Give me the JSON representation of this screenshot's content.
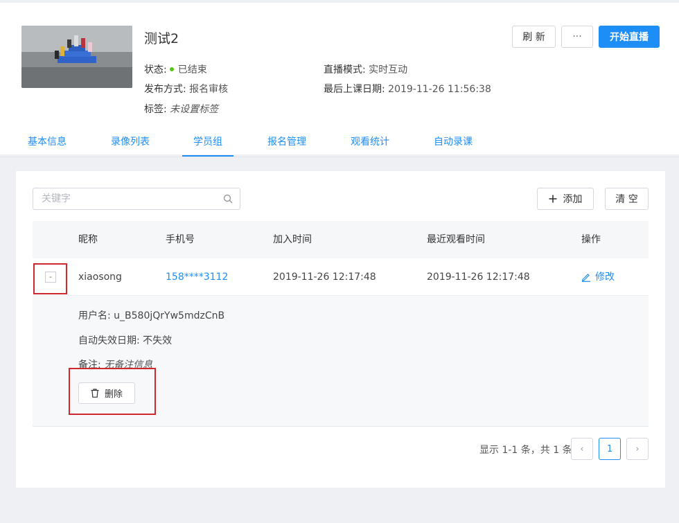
{
  "course": {
    "title": "测试2",
    "status_label": "状态:",
    "status_value": "已结束",
    "publish_label": "发布方式:",
    "publish_value": "报名审核",
    "tags_label": "标签:",
    "tags_value": "未设置标签",
    "mode_label": "直播模式:",
    "mode_value": "实时互动",
    "last_class_label": "最后上课日期:",
    "last_class_value": "2019-11-26 11:56:38"
  },
  "actions": {
    "refresh": "刷 新",
    "more": "···",
    "start": "开始直播"
  },
  "tabs": [
    {
      "label": "基本信息"
    },
    {
      "label": "录像列表"
    },
    {
      "label": "学员组"
    },
    {
      "label": "报名管理"
    },
    {
      "label": "观看统计"
    },
    {
      "label": "自动录课"
    }
  ],
  "toolbar": {
    "search_placeholder": "关键字",
    "add_label": "添加",
    "clear_label": "清 空"
  },
  "table": {
    "headers": [
      "昵称",
      "手机号",
      "加入时间",
      "最近观看时间",
      "操作"
    ],
    "rows": [
      {
        "expander": "-",
        "nickname": "xiaosong",
        "phone": "158****3112",
        "joined": "2019-11-26 12:17:48",
        "last_watch": "2019-11-26 12:17:48",
        "action": "修改"
      }
    ]
  },
  "detail": {
    "username_label": "用户名:",
    "username_value": "u_B580jQrYw5mdzCnB",
    "expire_label": "自动失效日期:",
    "expire_value": "不失效",
    "note_label": "备注:",
    "note_value": "无备注信息",
    "delete_label": "删除"
  },
  "pagination": {
    "summary": "显示 1-1 条，共 1 条",
    "prev": "‹",
    "current": "1",
    "next": "›"
  },
  "colors": {
    "accent": "#1e8ef7",
    "status_dot": "#52c41a",
    "highlight": "#d0262d"
  }
}
